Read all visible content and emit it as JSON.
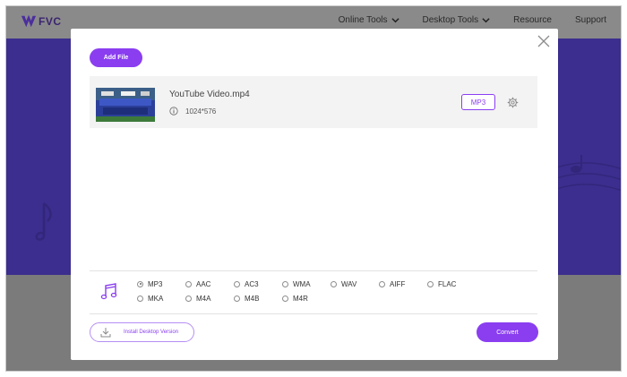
{
  "site": {
    "logo_text": "FVC",
    "nav": [
      {
        "label": "Online Tools",
        "has_dropdown": true
      },
      {
        "label": "Desktop Tools",
        "has_dropdown": true
      },
      {
        "label": "Resource",
        "has_dropdown": false
      },
      {
        "label": "Support",
        "has_dropdown": false
      }
    ]
  },
  "modal": {
    "add_file_label": "Add File",
    "file": {
      "name": "YouTube Video.mp4",
      "resolution": "1024*576",
      "format": "MP3"
    },
    "formats": {
      "row1": [
        "MP3",
        "AAC",
        "AC3",
        "WMA",
        "WAV",
        "AIFF",
        "FLAC"
      ],
      "row2": [
        "MKA",
        "M4A",
        "M4B",
        "M4R"
      ],
      "selected": "MP3"
    },
    "install_label": "Install Desktop Version",
    "convert_label": "Convert"
  },
  "colors": {
    "accent": "#8a3ef0",
    "hero": "#3b2e8e",
    "overlay": "#7b7b7b"
  },
  "icons": {
    "logo": "fvc-logo-icon",
    "dropdown": "chevron-down-icon",
    "close": "close-icon",
    "info": "info-icon",
    "settings": "gear-icon",
    "audio": "music-note-icon",
    "download": "download-icon"
  }
}
